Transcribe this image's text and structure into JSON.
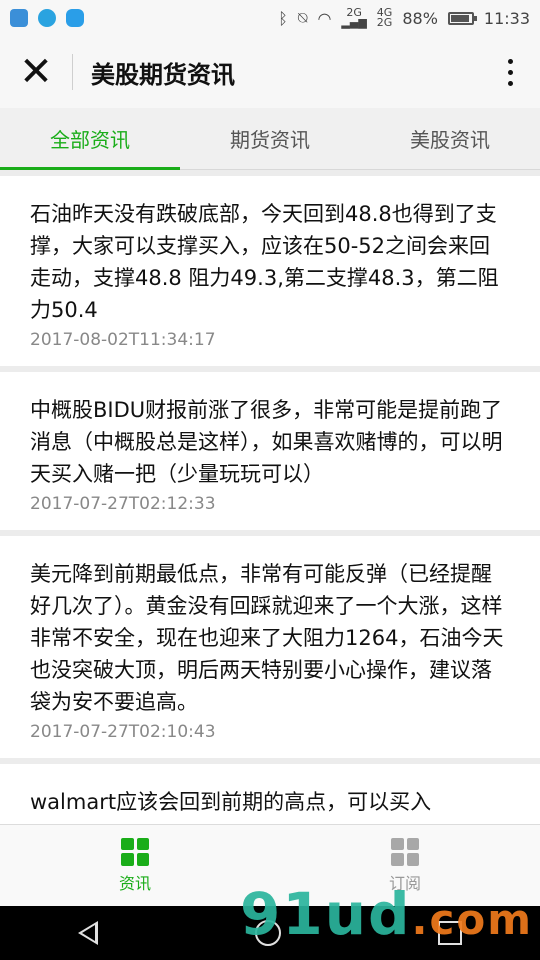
{
  "status_bar": {
    "battery": "88%",
    "time": "11:33",
    "net_2g": "2G",
    "net_4g": "4G",
    "net_2g_b": "2G"
  },
  "header": {
    "title": "美股期货资讯",
    "close_glyph": "✕"
  },
  "tabs": [
    {
      "label": "全部资讯",
      "active": true
    },
    {
      "label": "期货资讯",
      "active": false
    },
    {
      "label": "美股资讯",
      "active": false
    }
  ],
  "feed": [
    {
      "text": "石油昨天没有跌破底部，今天回到48.8也得到了支撑，大家可以支撑买入，应该在50-52之间会来回走动，支撑48.8 阻力49.3,第二支撑48.3，第二阻力50.4",
      "time": "2017-08-02T11:34:17"
    },
    {
      "text": "中概股BIDU财报前涨了很多，非常可能是提前跑了消息（中概股总是这样），如果喜欢赌博的，可以明天买入赌一把（少量玩玩可以）",
      "time": "2017-07-27T02:12:33"
    },
    {
      "text": "美元降到前期最低点，非常有可能反弹（已经提醒好几次了）。黄金没有回踩就迎来了一个大涨，这样非常不安全，现在也迎来了大阻力1264，石油今天也没突破大顶，明后两天特别要小心操作，建议落袋为安不要追高。",
      "time": "2017-07-27T02:10:43"
    },
    {
      "text": "walmart应该会回到前期的高点，可以买入",
      "time": ""
    }
  ],
  "bottom_nav": [
    {
      "label": "资讯",
      "icon": "grid-icon",
      "active": true
    },
    {
      "label": "订阅",
      "icon": "grid-icon",
      "active": false
    }
  ],
  "watermark": {
    "main": "91ud",
    "suffix": ".com"
  },
  "colors": {
    "accent": "#1aad19",
    "background": "#ececec",
    "inactive": "#999999"
  }
}
